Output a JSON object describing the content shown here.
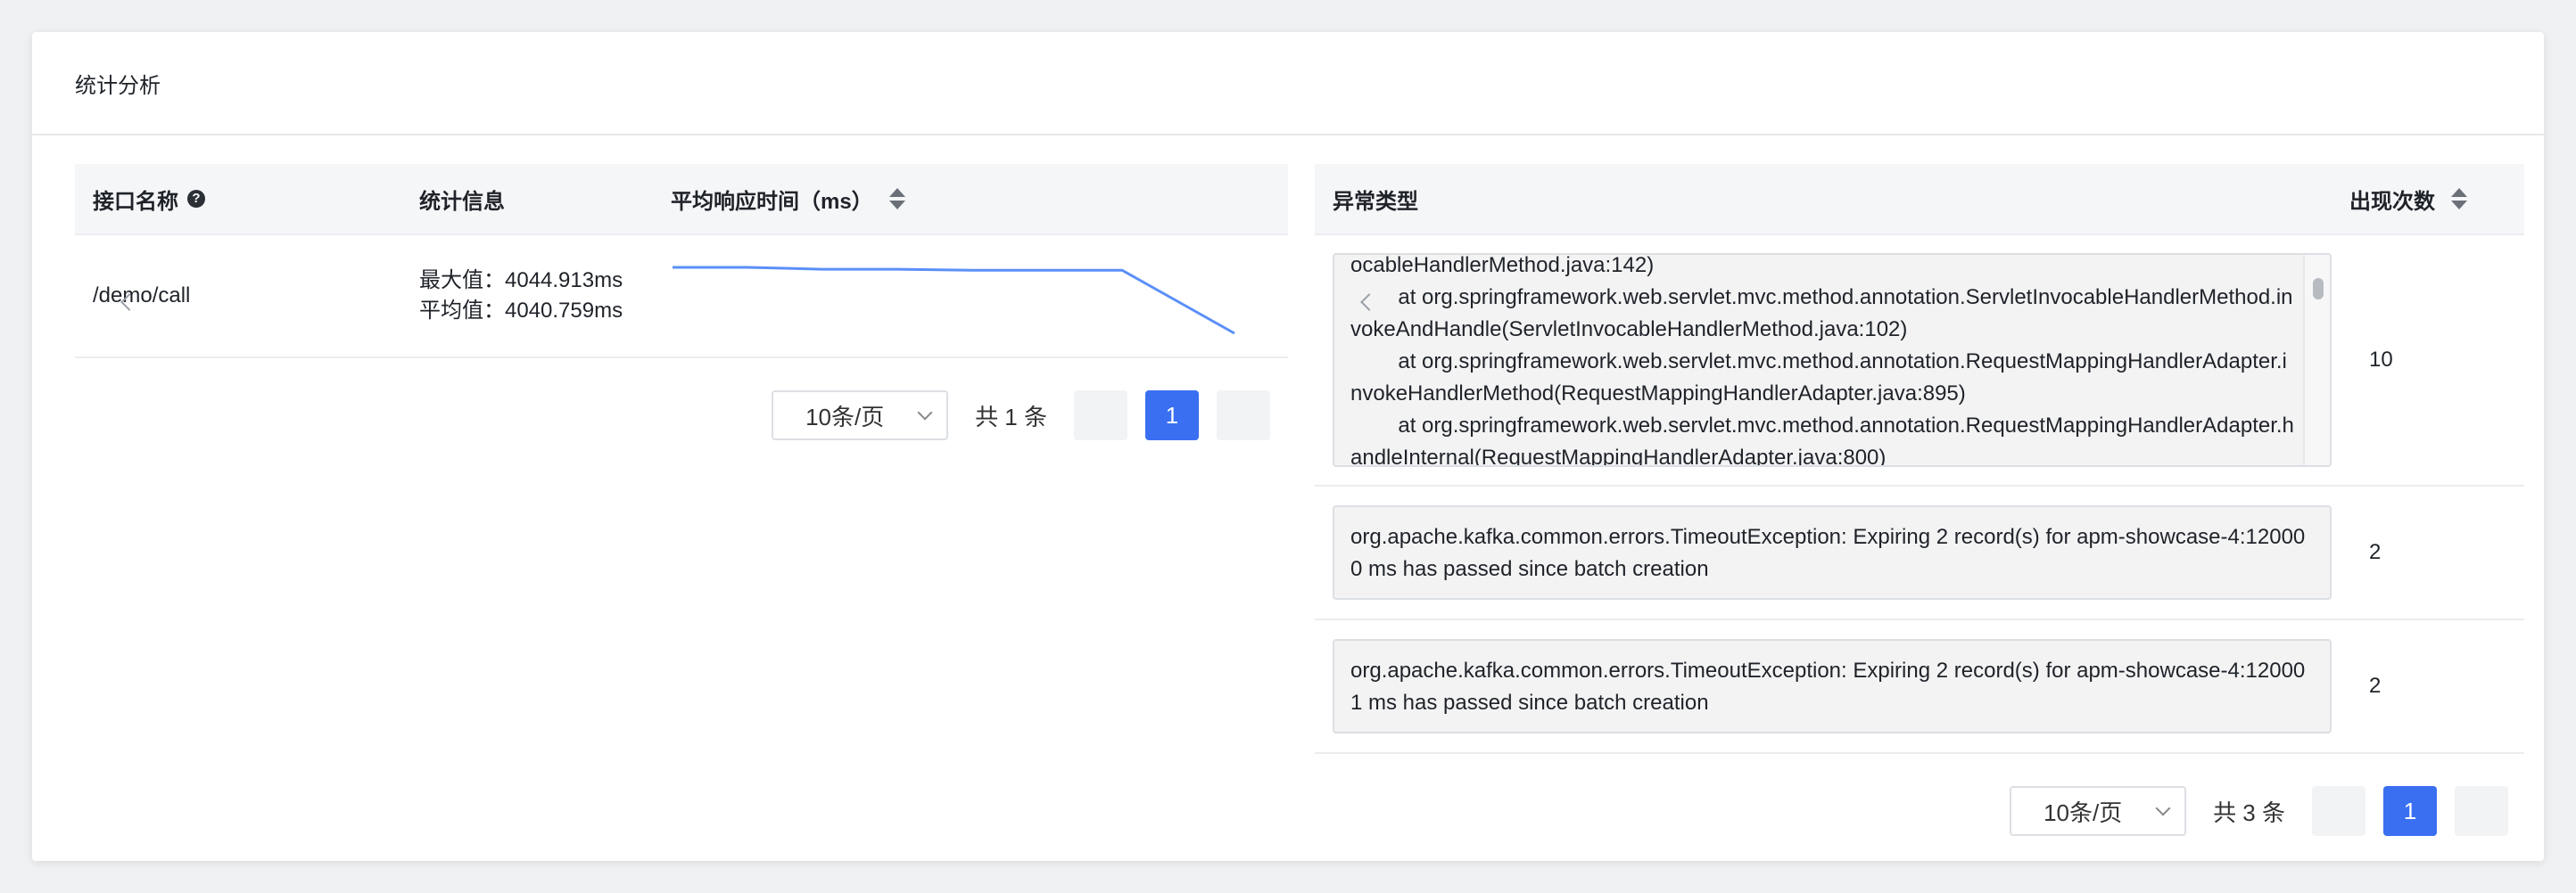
{
  "card": {
    "title": "统计分析"
  },
  "left_table": {
    "columns": [
      "接口名称",
      "统计信息",
      "平均响应时间（ms）"
    ],
    "rows": [
      {
        "name": "/demo/call",
        "max_label": "最大值：4044.913ms",
        "avg_label": "平均值：4040.759ms",
        "sparkline": [
          4044.9,
          4044.9,
          4044.7,
          4044.7,
          4044.6,
          4044.6,
          4044.6,
          4038.0
        ]
      }
    ],
    "pagination": {
      "page_size": "10条/页",
      "total": "共 1 条",
      "current_page": "1"
    }
  },
  "right_table": {
    "columns": [
      "异常类型",
      "出现次数"
    ],
    "rows": [
      {
        "exception": "ocableHandlerMethod.java:142)\n\tat org.springframework.web.servlet.mvc.method.annotation.ServletInvocableHandlerMethod.invokeAndHandle(ServletInvocableHandlerMethod.java:102)\n\tat org.springframework.web.servlet.mvc.method.annotation.RequestMappingHandlerAdapter.invokeHandlerMethod(RequestMappingHandlerAdapter.java:895)\n\tat org.springframework.web.servlet.mvc.method.annotation.RequestMappingHandlerAdapter.handleInternal(RequestMappingHandlerAdapter.java:800)",
        "count": "10"
      },
      {
        "exception": "org.apache.kafka.common.errors.TimeoutException: Expiring 2 record(s) for apm-showcase-4:120000 ms has passed since batch creation",
        "count": "2"
      },
      {
        "exception": "org.apache.kafka.common.errors.TimeoutException: Expiring 2 record(s) for apm-showcase-4:120001 ms has passed since batch creation",
        "count": "2"
      }
    ],
    "pagination": {
      "page_size": "10条/页",
      "total": "共 3 条",
      "current_page": "1"
    }
  },
  "colors": {
    "accent": "#3a6ff2",
    "sparkline": "#5b8ff9"
  },
  "icons": {
    "help": "question-circle-icon",
    "sort": "sort-icon",
    "prev": "chevron-left-icon",
    "next": "chevron-right-icon",
    "dropdown": "chevron-down-icon"
  }
}
